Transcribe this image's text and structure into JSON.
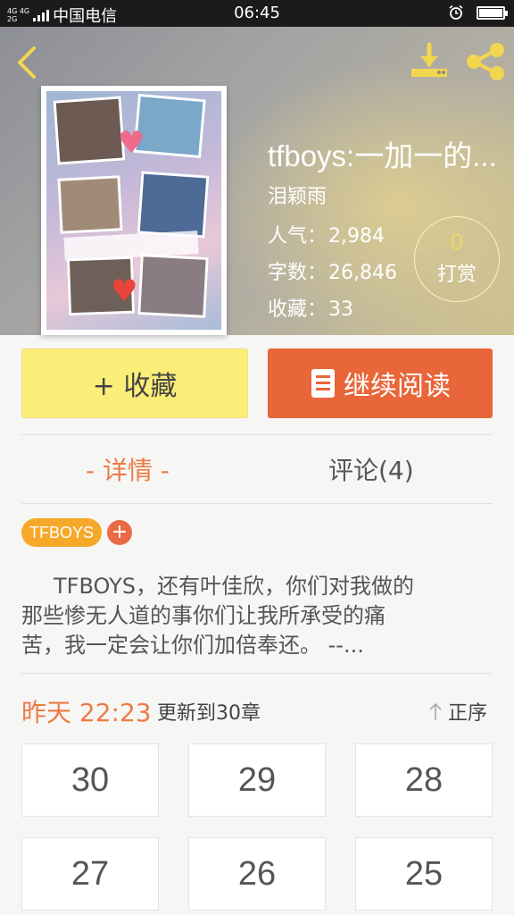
{
  "status_bar": {
    "signal_small": "4G 4G\n2G",
    "carrier": "中国电信",
    "time": "06:45"
  },
  "book": {
    "title": "tfboys:一加一的...",
    "author": "泪颖雨",
    "stats": [
      {
        "label": "人气：",
        "value": "2,984"
      },
      {
        "label": "字数：",
        "value": "26,846"
      },
      {
        "label": "收藏：",
        "value": "33"
      }
    ],
    "reward": {
      "count": "0",
      "label": "打赏"
    },
    "cover_icon": "book-cover-collage"
  },
  "actions": {
    "collect_label": "+ 收藏",
    "read_label": "继续阅读"
  },
  "tabs": [
    {
      "label": "- 详情 -",
      "active": true
    },
    {
      "label": "评论(4)",
      "active": false
    }
  ],
  "tags": [
    {
      "label": "TFBOYS"
    }
  ],
  "tag_add_label": "+",
  "synopsis": [
    "TFBOYS，还有叶佳欣，你们对我做的",
    "那些惨无人道的事你们让我所承受的痛",
    "苦，我一定会让你们加倍奉还。        --..."
  ],
  "update": {
    "time": "昨天 22:23",
    "text": "更新到30章",
    "sort_label": "正序"
  },
  "chapters": [
    "30",
    "29",
    "28",
    "27",
    "26",
    "25"
  ],
  "colors": {
    "accent_orange": "#e8663a",
    "tab_active": "#ef7a45",
    "collect_yellow": "#fbee78",
    "tag_orange": "#f6a82a"
  }
}
